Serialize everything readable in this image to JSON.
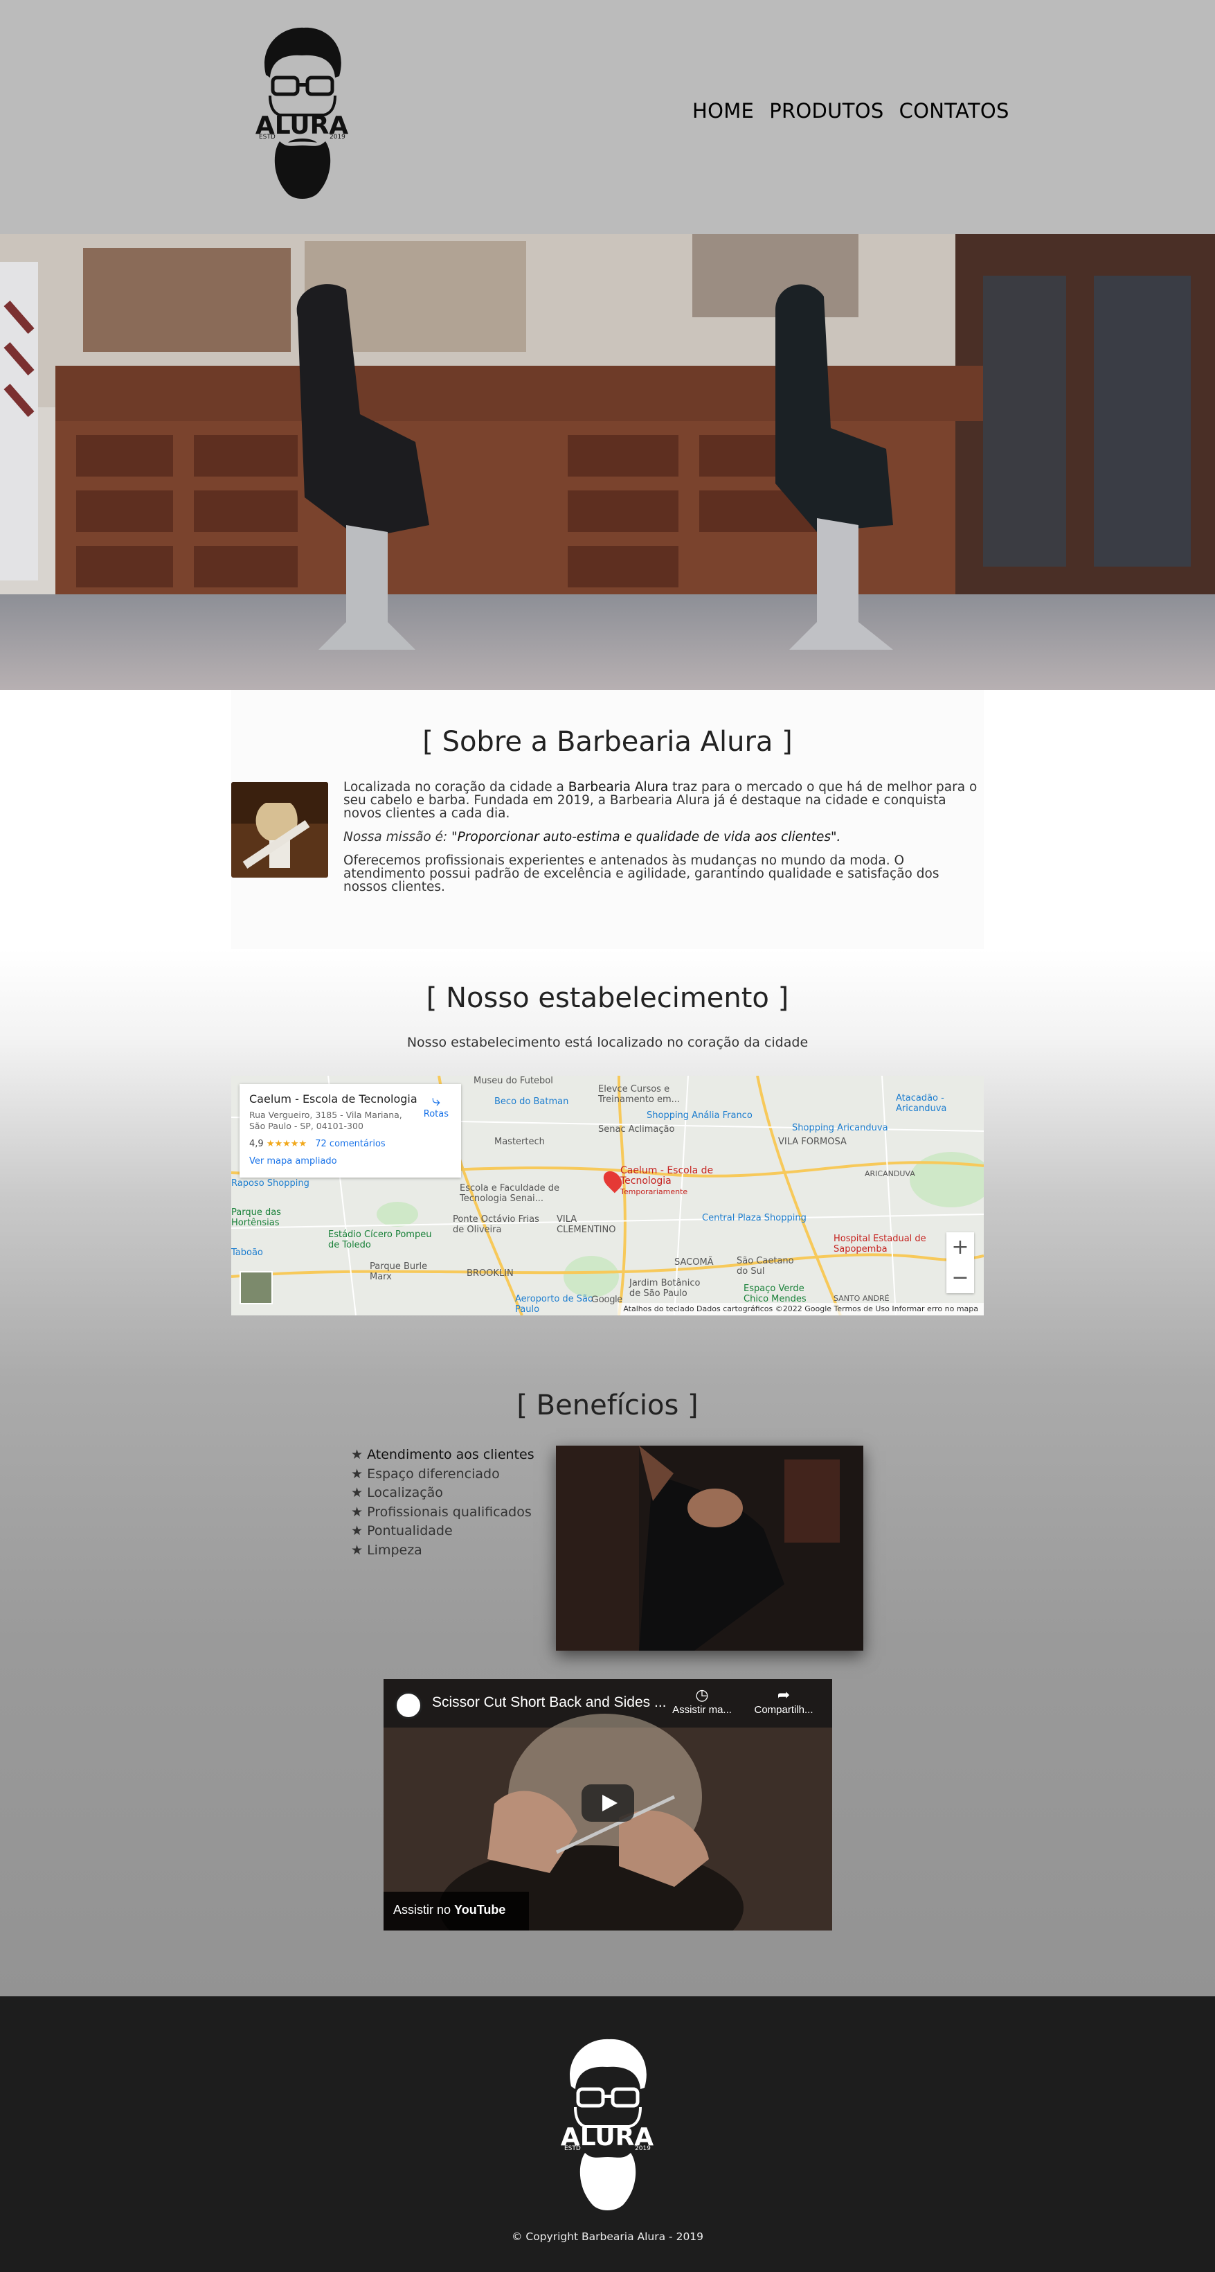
{
  "brand": {
    "name": "ALURA",
    "est": "ESTD",
    "year": "2019"
  },
  "nav": {
    "items": [
      "HOME",
      "PRODUTOS",
      "CONTATOS"
    ]
  },
  "about": {
    "title": "[ Sobre a Barbearia Alura ]",
    "p1_pre": "Localizada no coração da cidade a ",
    "p1_bold": "Barbearia Alura",
    "p1_post": " traz para o mercado o que há de melhor para o seu cabelo e barba. Fundada em 2019, a Barbearia Alura já é destaque na cidade e conquista novos clientes a cada dia.",
    "mission_label": "Nossa missão é: ",
    "mission_text": "\"Proporcionar auto-estima e qualidade de vida aos clientes\".",
    "p3": "Oferecemos profissionais experientes e antenados às mudanças no mundo da moda. O atendimento possui padrão de excelência e agilidade, garantindo qualidade e satisfação dos nossos clientes."
  },
  "location": {
    "title": "[ Nosso estabelecimento ]",
    "subtitle": "Nosso estabelecimento está localizado no coração da cidade"
  },
  "map": {
    "place": "Caelum - Escola de Tecnologia",
    "address1": "Rua Vergueiro, 3185 - Vila Mariana,",
    "address2": "São Paulo - SP, 04101-300",
    "rating": "4,9",
    "stars": "★★★★★",
    "reviews": "72 comentários",
    "larger": "Ver mapa ampliado",
    "route": "Rotas",
    "pin_label": "Caelum - Escola de Tecnologia",
    "pin_status": "Temporariamente",
    "labels": [
      "Museu do Futebol",
      "Beco do Batman",
      "Elevce Cursos e Treinamento em...",
      "Senac Aclimação",
      "Mastertech",
      "Shopping Anália Franco",
      "Shopping Aricanduva",
      "Atacadão - Aricanduva",
      "VILA FORMOSA",
      "ARICANDUVA",
      "Raposo Shopping",
      "Escola e Faculdade de Tecnologia Senai...",
      "Parque das Hortênsias",
      "Estádio Cícero Pompeu de Toledo",
      "Parque Burle Marx",
      "Ponte Octávio Frias de Oliveira",
      "VILA CLEMENTINO",
      "Central Plaza Shopping",
      "Hospital Estadual de Sapopemba",
      "BROOKLIN",
      "SACOMÃ",
      "São Caetano do Sul",
      "Jardim Botânico de São Paulo",
      "Espaço Verde Chico Mendes",
      "SANTO ANDRÉ",
      "Aeroporto de São Paulo",
      "Taboão"
    ],
    "footer": "Atalhos do teclado   Dados cartográficos ©2022 Google   Termos de Uso   Informar erro no mapa",
    "google": "Google"
  },
  "benefits": {
    "title": "[ Benefícios ]",
    "items": [
      "Atendimento aos clientes",
      "Espaço diferenciado",
      "Localização",
      "Profissionais qualificados",
      "Pontualidade",
      "Limpeza"
    ]
  },
  "video": {
    "title": "Scissor Cut Short Back and Sides ...",
    "watch_later": "Assistir ma...",
    "share": "Compartilh...",
    "watch_on": "Assistir no",
    "youtube": "YouTube"
  },
  "footer": {
    "copyright": "© Copyright Barbearia Alura - 2019"
  }
}
